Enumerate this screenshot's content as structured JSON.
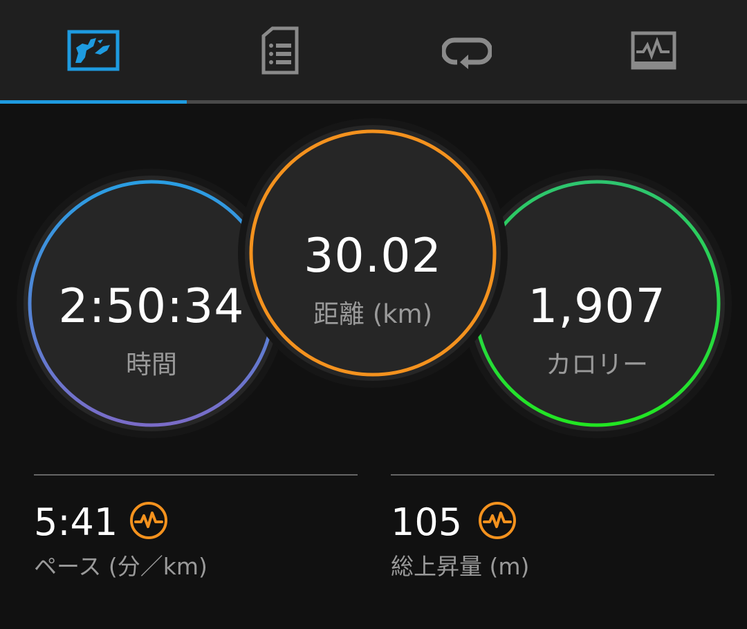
{
  "tabs": [
    {
      "icon": "map-icon",
      "active": true
    },
    {
      "icon": "document-list-icon",
      "active": false
    },
    {
      "icon": "laps-loop-icon",
      "active": false
    },
    {
      "icon": "graph-monitor-icon",
      "active": false
    }
  ],
  "summary": {
    "time": {
      "value": "2:50:34",
      "label": "時間",
      "ring_colors": [
        "#2a9ee3",
        "#7a6cc8"
      ]
    },
    "distance": {
      "value": "30.02",
      "label": "距離 (km)",
      "ring_color": "#f4921e"
    },
    "calories": {
      "value": "1,907",
      "label": "カロリー",
      "ring_colors": [
        "#2ec56f",
        "#22e622"
      ]
    }
  },
  "stats": {
    "pace": {
      "value": "5:41",
      "label": "ペース (分／km)",
      "icon": "pulse-icon"
    },
    "elevation": {
      "value": "105",
      "label": "総上昇量 (m)",
      "icon": "pulse-icon"
    }
  },
  "colors": {
    "accent_blue": "#1e9be0",
    "accent_orange": "#f4921e",
    "background": "#111111",
    "tab_background": "#1f1f1f"
  }
}
